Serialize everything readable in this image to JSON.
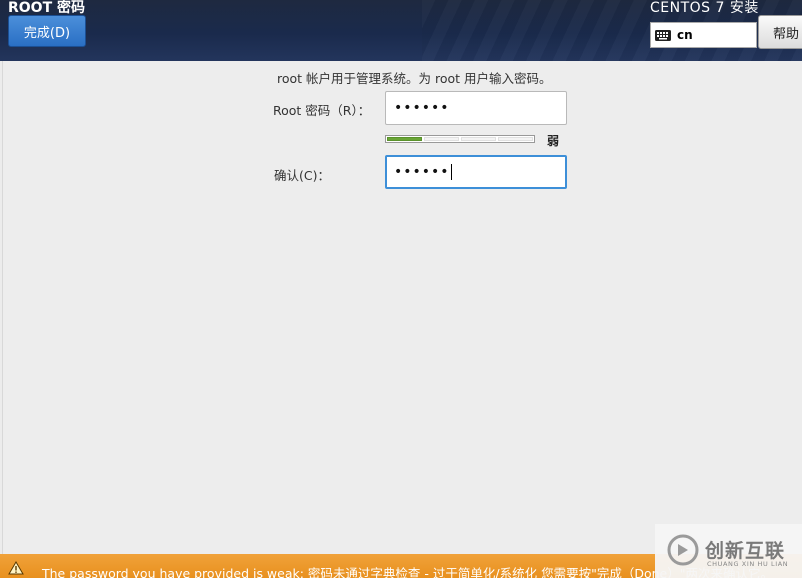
{
  "header": {
    "page_title": "ROOT 密码",
    "done_label": "完成(D)",
    "product_title": "CENTOS 7 安装",
    "keyboard_layout": "cn",
    "help_label": "帮助"
  },
  "form": {
    "intro": "root 帐户用于管理系统。为 root 用户输入密码。",
    "root_password_label": "Root 密码（R）：",
    "root_password_value": "••••••",
    "strength": {
      "label": "弱",
      "filled_segments": 1,
      "total_segments": 4
    },
    "confirm_label": "确认(C)：",
    "confirm_value": "••••••"
  },
  "warning": {
    "text": "The password you have provided is weak: 密码未通过字典检查 - 过于简单化/系统化 您需要按\"完成（Done）\"两次来确认它。"
  },
  "watermark": {
    "name": "创新互联",
    "sub": "CHUANG XIN HU LIAN"
  },
  "colors": {
    "header_bg": "#1a2a4c",
    "done_button": "#2a6fc4",
    "focus_border": "#3d8fd8",
    "strength_fill": "#6aa537",
    "warning_bg": "#e8901e"
  }
}
